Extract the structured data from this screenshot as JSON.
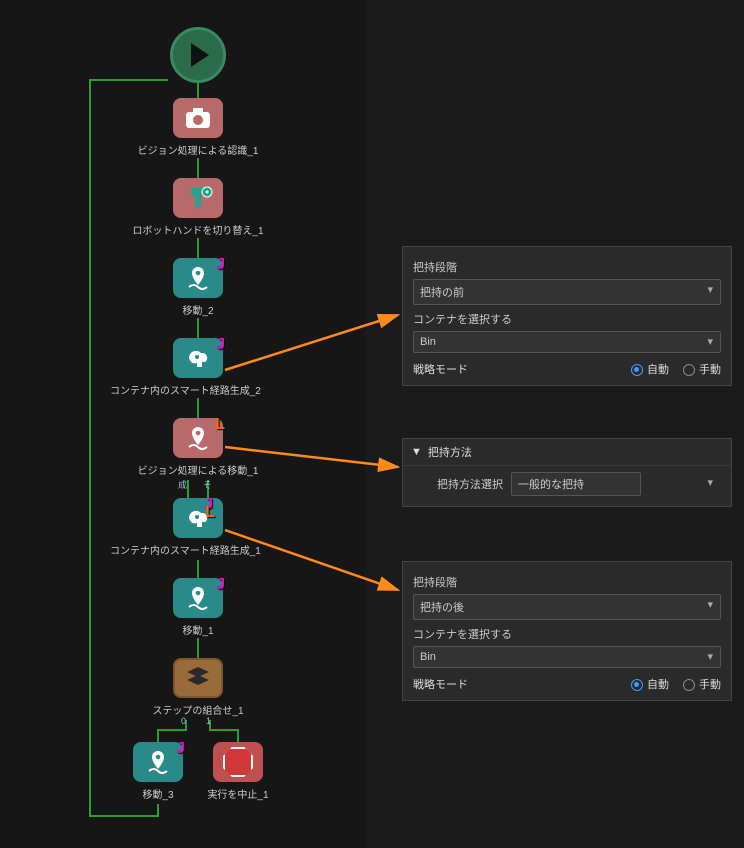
{
  "nodes": {
    "start": "start",
    "vision1_label": "ビジョン処理による認識_1",
    "tool_switch_label": "ロボットハンドを切り替え_1",
    "move2_label": "移動_2",
    "smart_path2_label": "コンテナ内のスマート経路生成_2",
    "vision_move1_label": "ビジョン処理による移動_1",
    "smart_path1_label": "コンテナ内のスマート経路生成_1",
    "move1_label": "移動_1",
    "step_combo_label": "ステップの組合せ_1",
    "move3_label": "移動_3",
    "stop_label": "実行を中止_1",
    "success_port": "成",
    "else_port": "そ",
    "port_0": "0",
    "port_1": "1"
  },
  "panel1": {
    "stage_label": "把持段階",
    "stage_value": "把持の前",
    "container_label": "コンテナを選択する",
    "container_value": "Bin",
    "mode_label": "戦略モード",
    "mode_auto": "自動",
    "mode_manual": "手動"
  },
  "panel2": {
    "header": "把持方法",
    "key": "把持方法選択",
    "value": "一般的な把持"
  },
  "panel3": {
    "stage_label": "把持段階",
    "stage_value": "把持の後",
    "container_label": "コンテナを選択する",
    "container_value": "Bin",
    "mode_label": "戦略モード",
    "mode_auto": "自動",
    "mode_manual": "手動"
  }
}
